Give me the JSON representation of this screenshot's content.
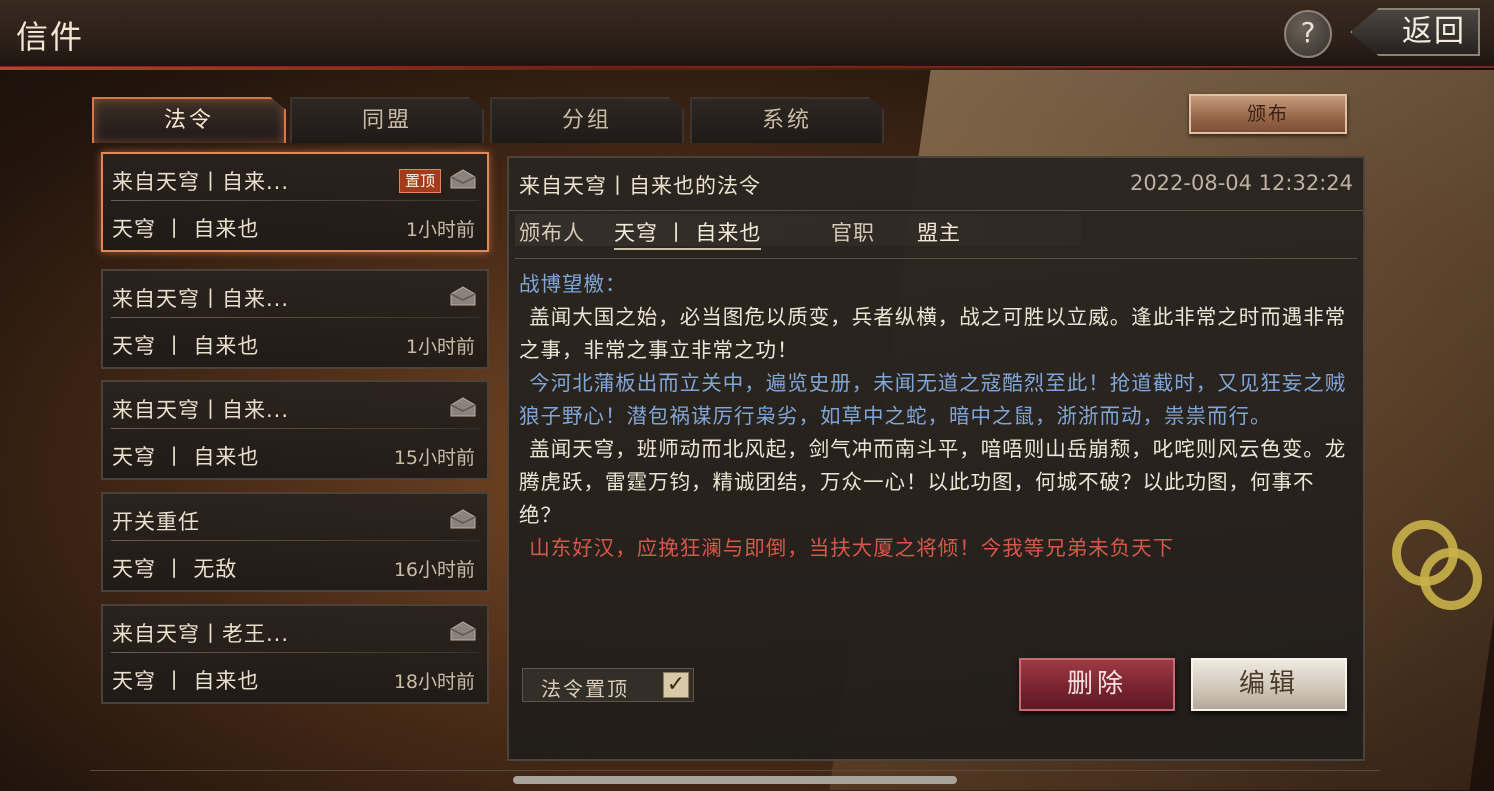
{
  "header": {
    "title": "信件",
    "help_label": "?",
    "back_label": "返回"
  },
  "tabs": [
    {
      "label": "法令",
      "active": true
    },
    {
      "label": "同盟",
      "active": false
    },
    {
      "label": "分组",
      "active": false
    },
    {
      "label": "系统",
      "active": false
    }
  ],
  "publish_button": "颁布",
  "mail_list": [
    {
      "subject": "来自天穹丨自来...",
      "sender": "天穹 丨 自来也",
      "time": "1小时前",
      "pinned_badge": "置顶",
      "selected": true
    },
    {
      "subject": "来自天穹丨自来...",
      "sender": "天穹 丨 自来也",
      "time": "1小时前",
      "selected": false
    },
    {
      "subject": "来自天穹丨自来...",
      "sender": "天穹 丨 自来也",
      "time": "15小时前",
      "selected": false
    },
    {
      "subject": "开关重任",
      "sender": "天穹 丨 无敌",
      "time": "16小时前",
      "selected": false
    },
    {
      "subject": "来自天穹丨老王...",
      "sender": "天穹 丨 自来也",
      "time": "18小时前",
      "selected": false
    }
  ],
  "detail": {
    "title": "来自天穹丨自来也的法令",
    "date": "2022-08-04 12:32:24",
    "publisher_label": "颁布人",
    "publisher_name": "天穹 丨 自来也",
    "office_label": "官职",
    "office_value": "盟主",
    "body": {
      "greeting": "战博望檄：",
      "p1": "盖闻大国之始，必当图危以质变，兵者纵横，战之可胜以立威。逢此非常之时而遇非常之事，非常之事立非常之功！",
      "p2": "今河北蒲板出而立关中，遍览史册，未闻无道之寇酷烈至此！抢道截时，又见狂妄之贼狼子野心！潜包祸谋厉行枭劣，如草中之蛇，暗中之鼠，浙浙而动，祟祟而行。",
      "p3": "盖闻天穹，班师动而北风起，剑气冲而南斗平，喑唔则山岳崩颓，叱咤则风云色变。龙腾虎跃，雷霆万钧，精诚团结，万众一心！以此功图，何城不破？以此功图，何事不绝？",
      "p4": "山东好汉，应挽狂澜与即倒，当扶大厦之将倾！今我等兄弟未负天下"
    },
    "pin_toggle_label": "法令置顶",
    "pin_checked_mark": "✓",
    "delete_label": "删除",
    "edit_label": "编辑"
  },
  "colors": {
    "accent": "#e08a5a",
    "delete": "#7a2430",
    "body_blue": "#7fa6d6",
    "body_red": "#d5574a"
  },
  "icons": {
    "mail": "envelope-icon",
    "help": "question-icon"
  }
}
